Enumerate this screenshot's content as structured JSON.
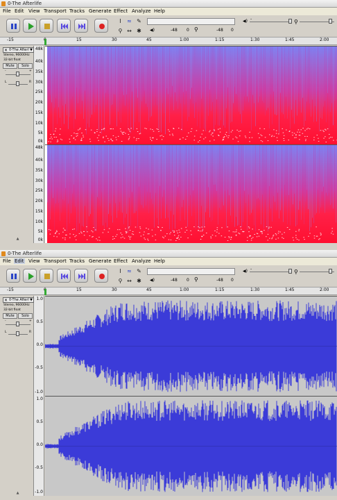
{
  "window_title": "0-The Afterlife",
  "menu": [
    "File",
    "Edit",
    "View",
    "Transport",
    "Tracks",
    "Generate",
    "Effect",
    "Analyze",
    "Help"
  ],
  "transport_buttons": [
    "pause",
    "play",
    "stop",
    "skip-to-start",
    "skip-to-end",
    "record"
  ],
  "meters": {
    "left_db": "-48",
    "zero": "0",
    "right_db": "-48",
    "right_zero": "0",
    "record_scale_minus": "-",
    "play_scale_plus": "+"
  },
  "ruler_ticks": [
    "-15",
    "0",
    "15",
    "30",
    "45",
    "1:00",
    "1:15",
    "1:30",
    "1:45",
    "2:00"
  ],
  "track": {
    "name": "0-The Afterl",
    "format": "Stereo, 96000Hz",
    "bit_depth": "32-bit float",
    "mute_label": "Mute",
    "solo_label": "Solo",
    "gain_minus": "-",
    "gain_plus": "+",
    "pan_left": "L",
    "pan_right": "R"
  },
  "spectrogram_axis": [
    "48k",
    "40k",
    "35k",
    "30k",
    "25k",
    "20k",
    "15k",
    "10k",
    "5k",
    "0k"
  ],
  "waveform_axis": [
    "1.0",
    "0.5",
    "0.0",
    "-0.5",
    "-1.0"
  ],
  "colors": {
    "waveform": "#3b3bd8",
    "spectro_low": "#ff2048",
    "spectro_high": "#7e7ef0"
  }
}
